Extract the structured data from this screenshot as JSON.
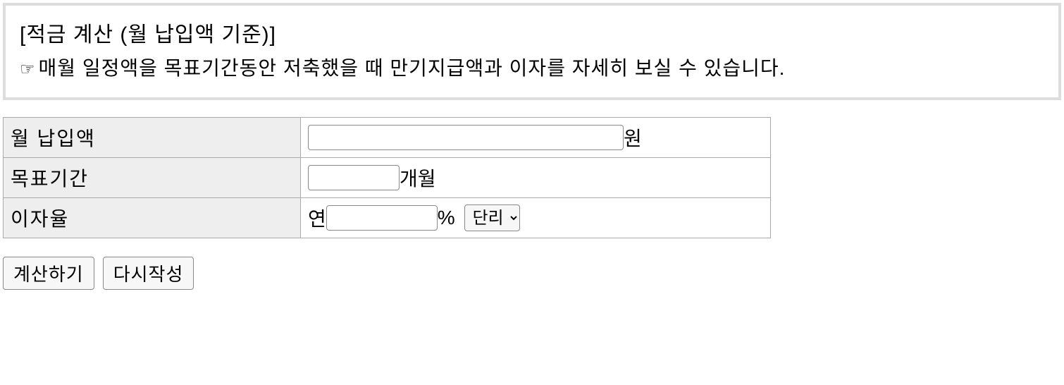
{
  "header": {
    "title": "[적금 계산 (월 납입액 기준)]",
    "description": "매월 일정액을 목표기간동안 저축했을 때 만기지급액과 이자를 자세히 보실 수 있습니다."
  },
  "form": {
    "rows": [
      {
        "label": "월 납입액",
        "unit": "원"
      },
      {
        "label": "목표기간",
        "unit": "개월"
      },
      {
        "label": "이자율",
        "prefix": "연",
        "unit": "%"
      }
    ],
    "interest_type": {
      "selected": "단리"
    }
  },
  "buttons": {
    "calculate": "계산하기",
    "reset": "다시작성"
  }
}
